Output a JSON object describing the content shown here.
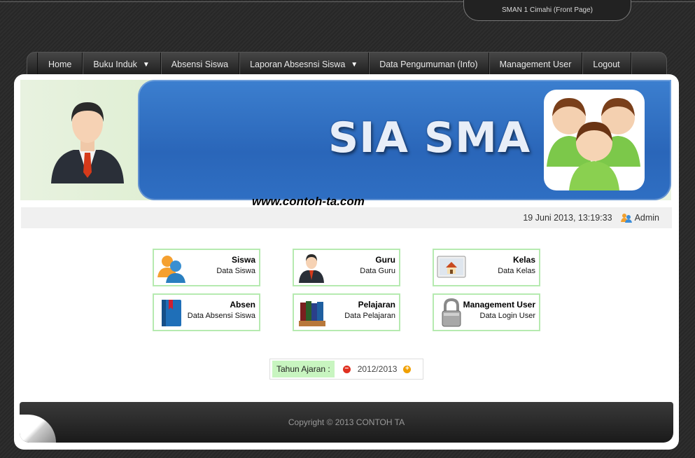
{
  "header": {
    "site_tab": "SMAN 1 Cimahi (Front Page)"
  },
  "nav": {
    "items": [
      {
        "label": "Home",
        "dropdown": false
      },
      {
        "label": "Buku Induk",
        "dropdown": true
      },
      {
        "label": "Absensi Siswa",
        "dropdown": false
      },
      {
        "label": "Laporan Absesnsi Siswa",
        "dropdown": true
      },
      {
        "label": "Data Pengumuman (Info)",
        "dropdown": false
      },
      {
        "label": "Management User",
        "dropdown": false
      },
      {
        "label": "Logout",
        "dropdown": false
      }
    ]
  },
  "banner": {
    "title": "SIA SMA",
    "watermark": "www.contoh-ta.com"
  },
  "status": {
    "datetime": "19 Juni 2013, 13:19:33",
    "user": "Admin"
  },
  "tiles": [
    {
      "title": "Siswa",
      "subtitle": "Data Siswa",
      "icon": "students-icon"
    },
    {
      "title": "Guru",
      "subtitle": "Data Guru",
      "icon": "teacher-icon"
    },
    {
      "title": "Kelas",
      "subtitle": "Data Kelas",
      "icon": "classroom-icon"
    },
    {
      "title": "Absen",
      "subtitle": "Data Absensi Siswa",
      "icon": "book-icon"
    },
    {
      "title": "Pelajaran",
      "subtitle": "Data Pelajaran",
      "icon": "books-icon"
    },
    {
      "title": "Management User",
      "subtitle": "Data Login User",
      "icon": "lock-icon"
    }
  ],
  "academic_year": {
    "label": "Tahun Ajaran :",
    "value": "2012/2013"
  },
  "footer": {
    "copyright": "Copyright © 2013 CONTOH TA"
  },
  "colors": {
    "accent_blue": "#2a66b9",
    "tile_border": "#b6eab0",
    "minus_red": "#e03020",
    "plus_orange": "#f0a000"
  }
}
